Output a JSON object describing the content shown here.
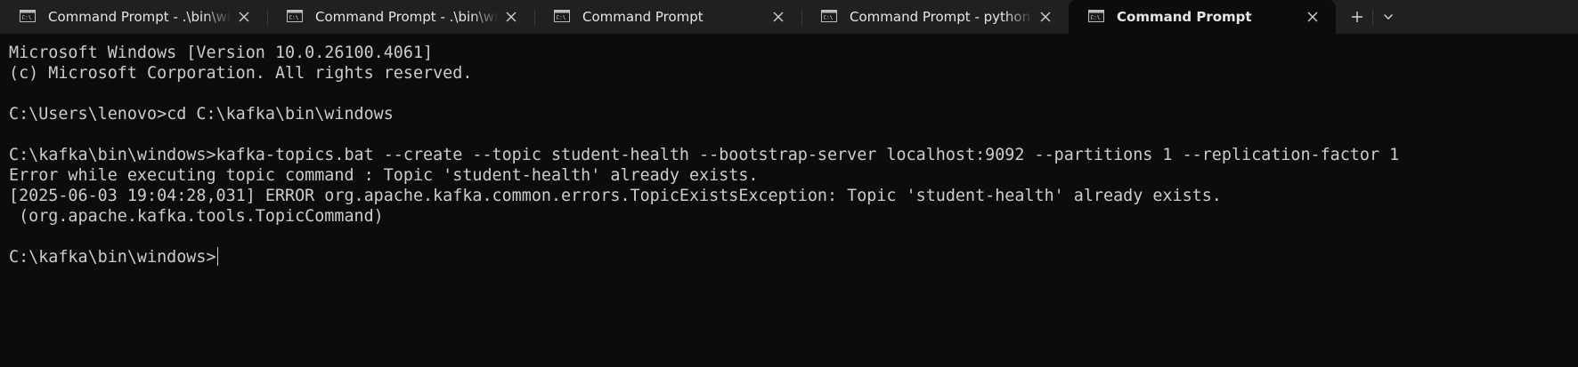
{
  "tabs": [
    {
      "title": "Command Prompt - .\\bin\\windows\\zookeeper-server-start.bat",
      "icon": "terminal-icon",
      "active": false
    },
    {
      "title": "Command Prompt - .\\bin\\windows\\kafka-server-start.bat",
      "icon": "terminal-icon",
      "active": false
    },
    {
      "title": "Command Prompt",
      "icon": "terminal-icon",
      "active": false
    },
    {
      "title": "Command Prompt - python consumer.py",
      "icon": "terminal-icon",
      "active": false
    },
    {
      "title": "Command Prompt",
      "icon": "terminal-icon",
      "active": true
    }
  ],
  "tab_actions": {
    "new_tab_icon": "plus-icon",
    "dropdown_icon": "chevron-down-icon"
  },
  "terminal": {
    "lines": [
      "Microsoft Windows [Version 10.0.26100.4061]",
      "(c) Microsoft Corporation. All rights reserved.",
      "",
      "C:\\Users\\lenovo>cd C:\\kafka\\bin\\windows",
      "",
      "C:\\kafka\\bin\\windows>kafka-topics.bat --create --topic student-health --bootstrap-server localhost:9092 --partitions 1 --replication-factor 1",
      "Error while executing topic command : Topic 'student-health' already exists.",
      "[2025-06-03 19:04:28,031] ERROR org.apache.kafka.common.errors.TopicExistsException: Topic 'student-health' already exists.",
      " (org.apache.kafka.tools.TopicCommand)",
      ""
    ],
    "prompt": "C:\\kafka\\bin\\windows>"
  },
  "colors": {
    "tabbar_bg": "#202020",
    "terminal_bg": "#0c0c0c",
    "terminal_fg": "#cccccc"
  }
}
